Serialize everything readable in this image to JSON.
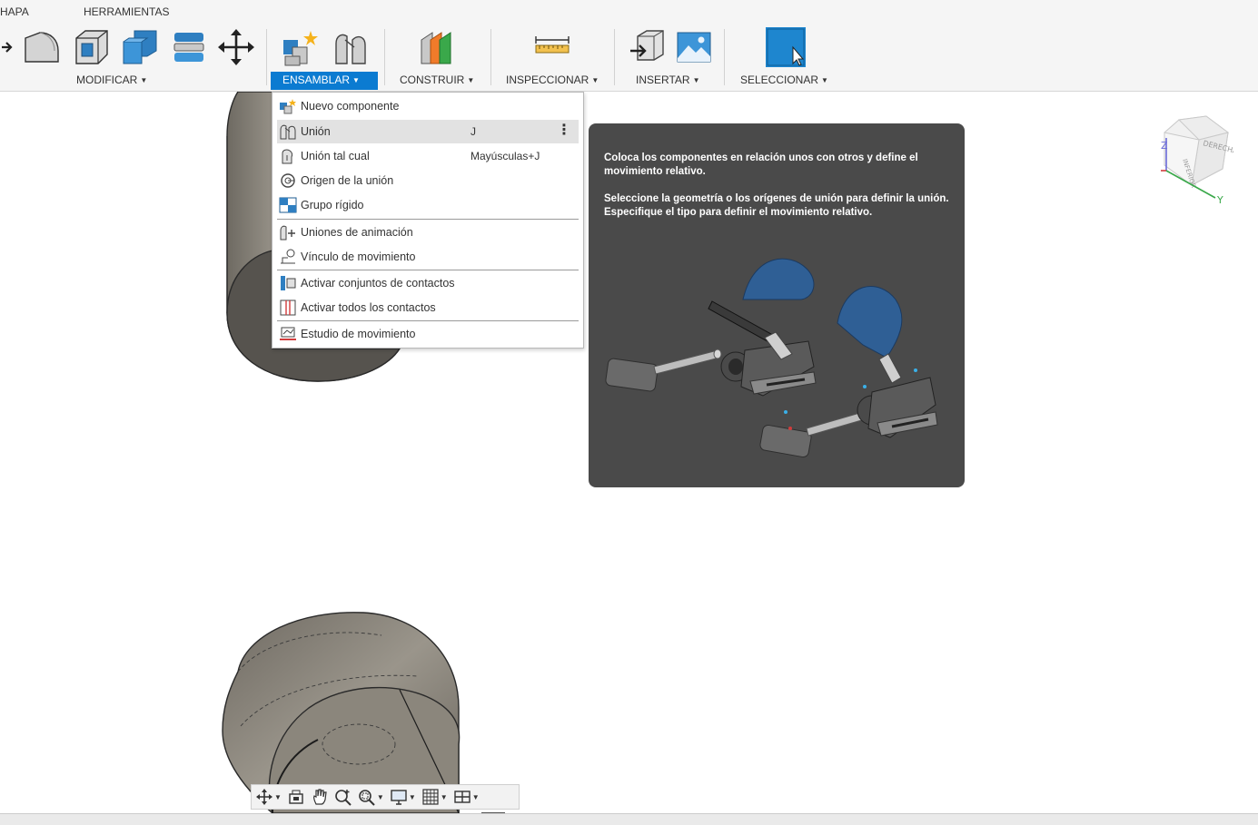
{
  "toolbar": {
    "tabs": [
      {
        "label": "HAPA"
      },
      {
        "label": "HERRAMIENTAS"
      }
    ],
    "groups": [
      {
        "label": "MODIFICAR"
      },
      {
        "label": "ENSAMBLAR"
      },
      {
        "label": "CONSTRUIR"
      },
      {
        "label": "INSPECCIONAR"
      },
      {
        "label": "INSERTAR"
      },
      {
        "label": "SELECCIONAR"
      }
    ],
    "active_group": "ENSAMBLAR",
    "accent_color": "#0b7bd1"
  },
  "menu": {
    "items": [
      {
        "label": "Nuevo componente",
        "shortcut": "",
        "icon": "new-component-icon"
      },
      {
        "label": "Unión",
        "shortcut": "J",
        "icon": "joint-icon"
      },
      {
        "label": "Unión tal cual",
        "shortcut": "Mayúsculas+J",
        "icon": "as-built-joint-icon"
      },
      {
        "label": "Origen de la unión",
        "shortcut": "",
        "icon": "joint-origin-icon"
      },
      {
        "label": "Grupo rígido",
        "shortcut": "",
        "icon": "rigid-group-icon"
      },
      {
        "label": "Uniones de animación",
        "shortcut": "",
        "icon": "drive-joints-icon"
      },
      {
        "label": "Vínculo de movimiento",
        "shortcut": "",
        "icon": "motion-link-icon"
      },
      {
        "label": "Activar conjuntos de contactos",
        "shortcut": "",
        "icon": "contact-sets-icon"
      },
      {
        "label": "Activar todos los contactos",
        "shortcut": "",
        "icon": "all-contacts-icon"
      },
      {
        "label": "Estudio de movimiento",
        "shortcut": "",
        "icon": "motion-study-icon"
      }
    ],
    "highlighted": "Unión"
  },
  "tooltip": {
    "paragraph1": "Coloca los componentes en relación unos con otros y define el movimiento relativo.",
    "paragraph2": "Seleccione la geometría o los orígenes de unión para definir la unión. Especifique el tipo para definir el movimiento relativo."
  },
  "viewcube": {
    "face_right": "DERECHA",
    "face_front": "INFERIOR",
    "axis_z": "Z",
    "axis_y": "Y"
  },
  "navbar": {
    "tools": [
      "orbit-icon",
      "look-at-icon",
      "pan-icon",
      "zoom-icon",
      "fit-icon",
      "display-settings-icon",
      "grid-icon",
      "viewports-icon"
    ]
  }
}
